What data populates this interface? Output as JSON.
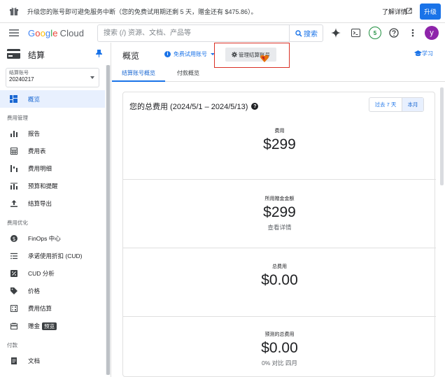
{
  "promo": {
    "message": "升级您的账号即可避免服务中断（您的免费试用期还剩 5 天，赠金还有 $475.86）。",
    "learn_more": "了解详情",
    "upgrade": "升级"
  },
  "header": {
    "logo_letters": [
      "G",
      "o",
      "o",
      "g",
      "l",
      "e"
    ],
    "logo_product": "Cloud",
    "search_placeholder": "搜索 (/) 资源、文档、产品等",
    "search_button": "搜索",
    "notification_count": "5",
    "avatar_letter": "y"
  },
  "sidebar": {
    "title": "结算",
    "account_label": "结算账号",
    "account_value": "20240217",
    "overview": "概览",
    "sections": [
      {
        "label": "费用管理",
        "items": [
          {
            "label": "报告",
            "icon": "bar-chart-icon"
          },
          {
            "label": "费用表",
            "icon": "table-icon"
          },
          {
            "label": "费用明细",
            "icon": "waterfall-chart-icon"
          },
          {
            "label": "预算和提醒",
            "icon": "budget-chart-icon"
          },
          {
            "label": "结算导出",
            "icon": "upload-icon"
          }
        ]
      },
      {
        "label": "费用优化",
        "items": [
          {
            "label": "FinOps 中心",
            "icon": "dollar-circle-icon"
          },
          {
            "label": "承诺使用折扣 (CUD)",
            "icon": "list-percent-icon"
          },
          {
            "label": "CUD 分析",
            "icon": "percent-box-icon"
          },
          {
            "label": "价格",
            "icon": "tag-icon"
          },
          {
            "label": "费用估算",
            "icon": "calculator-icon"
          },
          {
            "label": "赠金",
            "icon": "gift-card-icon",
            "tag": "预览"
          }
        ]
      },
      {
        "label": "付款",
        "items": [
          {
            "label": "文档",
            "icon": "document-icon"
          }
        ]
      }
    ]
  },
  "main": {
    "title": "概览",
    "trial_account": "免费试用账号",
    "manage_button": "管理结算账号",
    "learn": "学习",
    "tabs": [
      "结算账号概览",
      "付款概览"
    ],
    "card": {
      "title": "您的总费用 (2024/5/1 – 2024/5/13)",
      "range_options": [
        "过去 7 天",
        "本月"
      ],
      "selected_range": "本月",
      "metrics": [
        {
          "label": "费用",
          "value": "$299",
          "sub": ""
        },
        {
          "label": "所用赠金金额",
          "value": "$299",
          "sub": "查看详情"
        },
        {
          "label": "总费用",
          "value": "$0.00",
          "sub": ""
        },
        {
          "label": "预测的总费用",
          "value": "$0.00",
          "sub": "0% 对比 四月"
        }
      ]
    }
  },
  "colors": {
    "accent": "#1a73e8",
    "active_bg": "#e8f0fe",
    "highlight_border": "#d93025",
    "avatar": "#8e24aa",
    "badge": "#1e8e3e"
  }
}
